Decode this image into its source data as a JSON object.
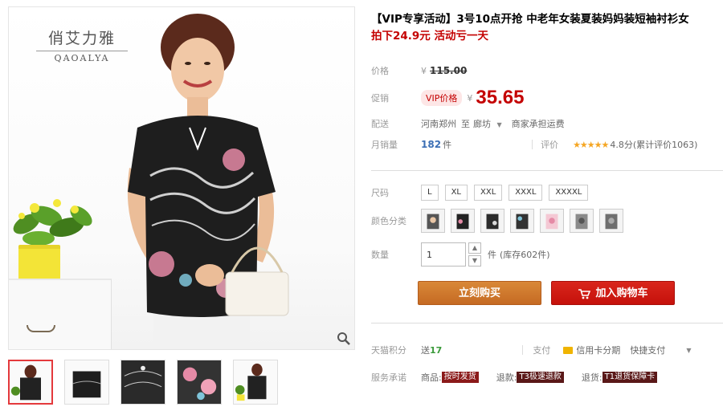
{
  "brand": {
    "name_cn": "俏艾力雅",
    "name_en": "QAOALYA"
  },
  "title": {
    "main": "【VIP专享活动】3号10点开抢 中老年女装夏装妈妈装短袖衬衫女",
    "sub": "拍下24.9元 活动亏一天"
  },
  "price": {
    "label": "价格",
    "currency": "¥",
    "original": "115.00"
  },
  "promo": {
    "label": "促销",
    "badge": "VIP价格",
    "currency": "¥",
    "price": "35.65"
  },
  "shipping": {
    "label": "配送",
    "from": "河南郑州",
    "to_word": "至",
    "to": "廊坊",
    "fee": "商家承担运费"
  },
  "sales": {
    "label": "月销量",
    "count": "182",
    "unit": "件",
    "rating_label": "评价",
    "stars": "★★★★★",
    "rating": "4.8分",
    "review_count": "(累计评价1063)"
  },
  "sizes": {
    "label": "尺码",
    "options": [
      "L",
      "XL",
      "XXL",
      "XXXL",
      "XXXXL"
    ]
  },
  "colors": {
    "label": "颜色分类",
    "count": 7
  },
  "quantity": {
    "label": "数量",
    "value": "1",
    "unit": "件",
    "stock": "(库存602件)"
  },
  "actions": {
    "buy": "立刻购买",
    "cart": "加入购物车"
  },
  "points": {
    "label": "天猫积分",
    "prefix": "送",
    "value": "17",
    "pay_label": "支付",
    "credit": "信用卡分期",
    "quick": "快捷支付"
  },
  "service": {
    "label": "服务承诺",
    "goods_label": "商品:",
    "goods_tag": "按时发货",
    "refund_label": "退款:",
    "refund_tag": "T3极速退款",
    "return_label": "退货:",
    "return_tag": "T1退货保障卡"
  },
  "colors_palette": {
    "price_red": "#c40000",
    "buy_orange": "#d0742a",
    "cart_red": "#d9261c"
  }
}
